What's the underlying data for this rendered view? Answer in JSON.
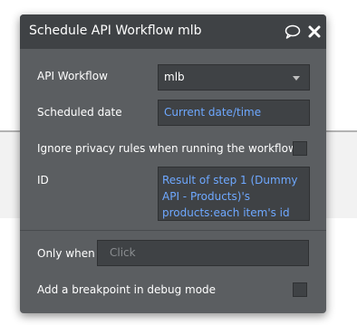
{
  "dialog": {
    "title": "Schedule API Workflow mlb",
    "icons": {
      "comment": "comment-icon",
      "close": "close-icon"
    }
  },
  "fields": {
    "api_workflow_label": "API Workflow",
    "api_workflow_value": "mlb",
    "scheduled_date_label": "Scheduled date",
    "scheduled_date_value": "Current date/time",
    "ignore_privacy_label": "Ignore privacy rules when running the workflow",
    "id_label": "ID",
    "id_value": "Result of step 1 (Dummy API - Products)'s products:each item's id",
    "only_when_label": "Only when",
    "only_when_placeholder": "Click",
    "breakpoint_label": "Add a breakpoint in debug mode"
  },
  "colors": {
    "panel_bg": "#5b5e61",
    "header_bg": "#3f4245",
    "field_bg": "#3f4245",
    "dynamic_text": "#6ea8ff"
  }
}
